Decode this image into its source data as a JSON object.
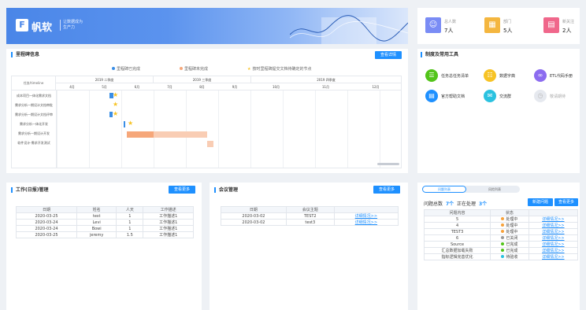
{
  "banner": {
    "logo_text": "帆软",
    "slogan_1": "让数据成为",
    "slogan_2": "生产力"
  },
  "stats": [
    {
      "icon": "user-icon",
      "label": "总人数",
      "value": "7人",
      "color": "#7a8cf5"
    },
    {
      "icon": "building-icon",
      "label": "部门",
      "value": "5人",
      "color": "#f4b63f"
    },
    {
      "icon": "document-icon",
      "label": "新关注",
      "value": "2人",
      "color": "#f0678b"
    }
  ],
  "gantt": {
    "title": "里程碑信息",
    "view_button": "查看详情",
    "legend": [
      {
        "label": "里程碑已完成",
        "color": "#3a8ee6"
      },
      {
        "label": "里程碑未完成",
        "color": "#f6a77a"
      },
      {
        "label": "按时里程碑提交文档待确定的节点",
        "color": "#f7c325"
      }
    ],
    "header_col": "任务/timeline",
    "periods": [
      "2019 二季度",
      "2019 三季度",
      "2019 四季度"
    ],
    "months": [
      "4月",
      "5月",
      "6月",
      "7月",
      "8月",
      "9月",
      "10月",
      "11月",
      "12月"
    ],
    "tasks": [
      "成本项目一体化需求文档",
      "需求分析一期设计文档审批",
      "需求分析一期设计文档评审",
      "需求分析一体化开发",
      "需求分析一期设计开发",
      "软件设计-需求开发测试"
    ]
  },
  "tools": {
    "title": "制度及常用工具",
    "items": [
      {
        "icon": "list-icon",
        "label": "任务总任务清单",
        "color": "#52c41a"
      },
      {
        "icon": "book-icon",
        "label": "数据字典",
        "color": "#f7c325"
      },
      {
        "icon": "code-icon",
        "label": "ETL代码手册",
        "color": "#8c6cf0"
      },
      {
        "icon": "doc-icon",
        "label": "官方帮助文档",
        "color": "#1e90ff"
      },
      {
        "icon": "chat-icon",
        "label": "交流群",
        "color": "#2bc2e0"
      },
      {
        "icon": "clock-icon",
        "label": "敬请期待",
        "color": "#e6e9ef"
      }
    ]
  },
  "worklog": {
    "title": "工作(日报)管理",
    "view_button": "查看更多",
    "columns": [
      "日期",
      "姓名",
      "人天",
      "工作描述"
    ],
    "rows": [
      [
        "2020-03-25",
        "test",
        "1",
        "工作描述1"
      ],
      [
        "2020-03-24",
        "Levi",
        "1",
        "工作描述1"
      ],
      [
        "2020-03-24",
        "Bowi",
        "1",
        "工作描述1"
      ],
      [
        "2020-03-25",
        "jeremy",
        "1.5",
        "工作描述1"
      ]
    ]
  },
  "meeting": {
    "title": "会议管理",
    "view_button": "查看更多",
    "columns": [
      "日期",
      "会议主题",
      ""
    ],
    "rows": [
      [
        "2020-03-02",
        "TEST2",
        "详细情况>>"
      ],
      [
        "2020-03-02",
        "test3",
        "详细情况>>"
      ]
    ]
  },
  "issues": {
    "tab_active": "问题列表",
    "tab_inactive": "风险列表",
    "summary_label": "问题总数",
    "summary_value": "7个",
    "pending_label": "正在处理",
    "pending_value": "3个",
    "add_button": "新建问题",
    "more_button": "查看更多",
    "columns": [
      "问题内容",
      "状态",
      ""
    ],
    "rows": [
      {
        "content": "5",
        "status": "处理中",
        "color": "#f7a23b",
        "link": "详细情况>>"
      },
      {
        "content": "4",
        "status": "处理中",
        "color": "#f7a23b",
        "link": "详细情况>>"
      },
      {
        "content": "TEST3",
        "status": "处理中",
        "color": "#f7a23b",
        "link": "详细情况>>"
      },
      {
        "content": "6",
        "status": "已关闭",
        "color": "#999999",
        "link": "详细情况>>"
      },
      {
        "content": "Source",
        "status": "已完成",
        "color": "#52c41a",
        "link": "详细情况>>"
      },
      {
        "content": "汇总数据加载失败",
        "status": "已完成",
        "color": "#52c41a",
        "link": "详细情况>>"
      },
      {
        "content": "指标逻辑完善优化",
        "status": "待验收",
        "color": "#2bc2e0",
        "link": "详细情况>>"
      }
    ]
  }
}
